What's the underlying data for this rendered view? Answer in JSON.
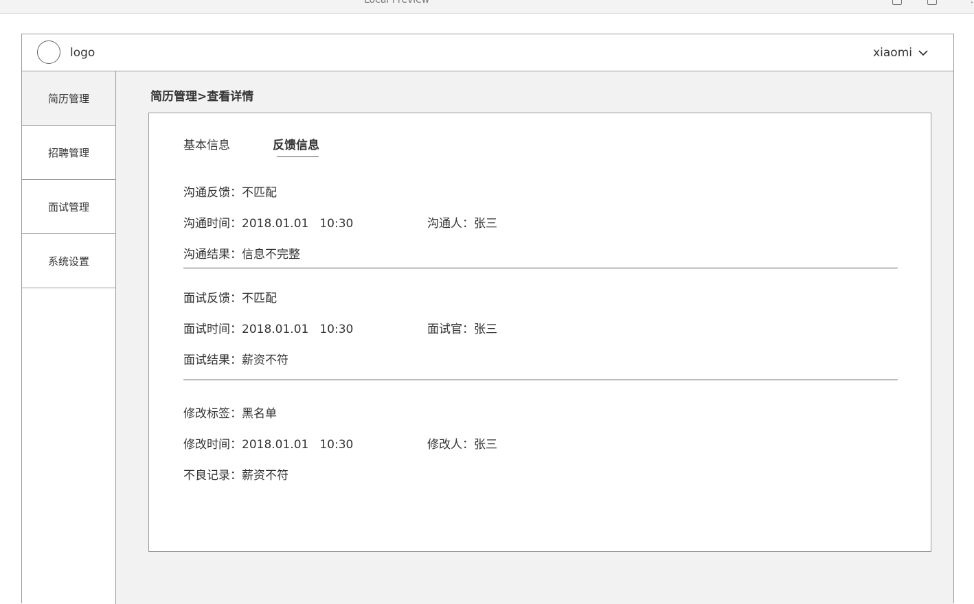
{
  "browser": {
    "title": "Local Preview"
  },
  "header": {
    "logo_text": "logo",
    "user_name": "xiaomi"
  },
  "sidebar": {
    "items": [
      {
        "label": "简历管理"
      },
      {
        "label": "招聘管理"
      },
      {
        "label": "面试管理"
      },
      {
        "label": "系统设置"
      }
    ]
  },
  "breadcrumb": "简历管理>查看详情",
  "tabs": [
    {
      "label": "基本信息"
    },
    {
      "label": "反馈信息"
    }
  ],
  "communication": {
    "feedback_label": "沟通反馈：",
    "feedback_value": "不匹配",
    "time_label": "沟通时间：",
    "time_date": "2018.01.01",
    "time_clock": "10:30",
    "person_label": "沟通人：",
    "person_value": "张三",
    "result_label": "沟通结果：",
    "result_value": "信息不完整"
  },
  "interview": {
    "feedback_label": "面试反馈：",
    "feedback_value": "不匹配",
    "time_label": "面试时间：",
    "time_date": "2018.01.01",
    "time_clock": "10:30",
    "person_label": "面试官：",
    "person_value": "张三",
    "result_label": "面试结果：",
    "result_value": "薪资不符"
  },
  "modification": {
    "tag_label": "修改标签：",
    "tag_value": "黑名单",
    "time_label": "修改时间：",
    "time_date": "2018.01.01",
    "time_clock": "10:30",
    "person_label": "修改人：",
    "person_value": "张三",
    "record_label": "不良记录：",
    "record_value": "薪资不符"
  }
}
